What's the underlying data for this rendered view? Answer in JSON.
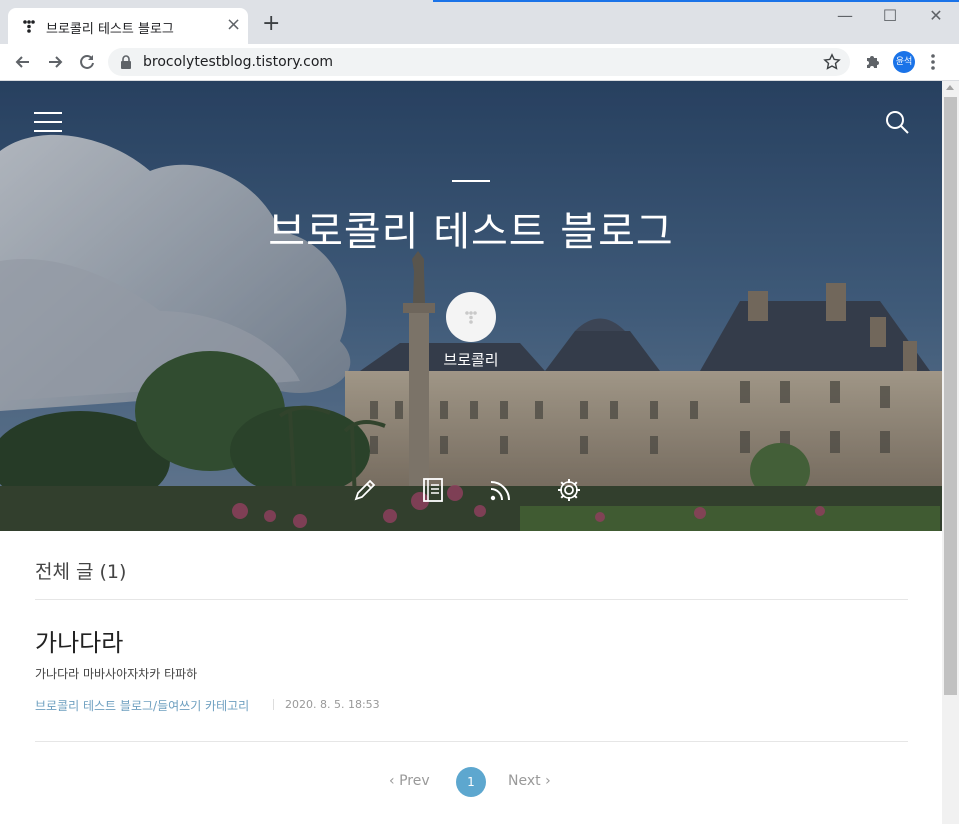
{
  "browser": {
    "tab_title": "브로콜리 테스트 블로그",
    "tab_close": "×",
    "new_tab": "+",
    "url": "brocolytestblog.tistory.com",
    "profile_initials": "윤석",
    "window_controls": {
      "minimize": "—",
      "maximize": "☐",
      "close": "✕"
    }
  },
  "blog": {
    "title": "브로콜리 테스트 블로그",
    "profile_name": "브로콜리",
    "section_title": "전체 글 (1)",
    "post": {
      "title": "가나다라",
      "excerpt": "가나다라 마바사아자차카 타파하",
      "category": "브로콜리 테스트 블로그/들여쓰기 카테고리",
      "date": "2020. 8. 5. 18:53"
    },
    "pagination": {
      "prev": "Prev",
      "current": "1",
      "next": "Next"
    }
  },
  "icons": [
    "menu-icon",
    "search-icon",
    "pencil-icon",
    "notebook-icon",
    "rss-icon",
    "gear-icon",
    "lock-icon",
    "star-icon",
    "puzzle-icon",
    "back-icon",
    "forward-icon",
    "reload-icon"
  ],
  "colors": {
    "accent": "#5da7cf",
    "category_link": "#6fa0c0",
    "chrome_frame": "#dee1e6"
  }
}
